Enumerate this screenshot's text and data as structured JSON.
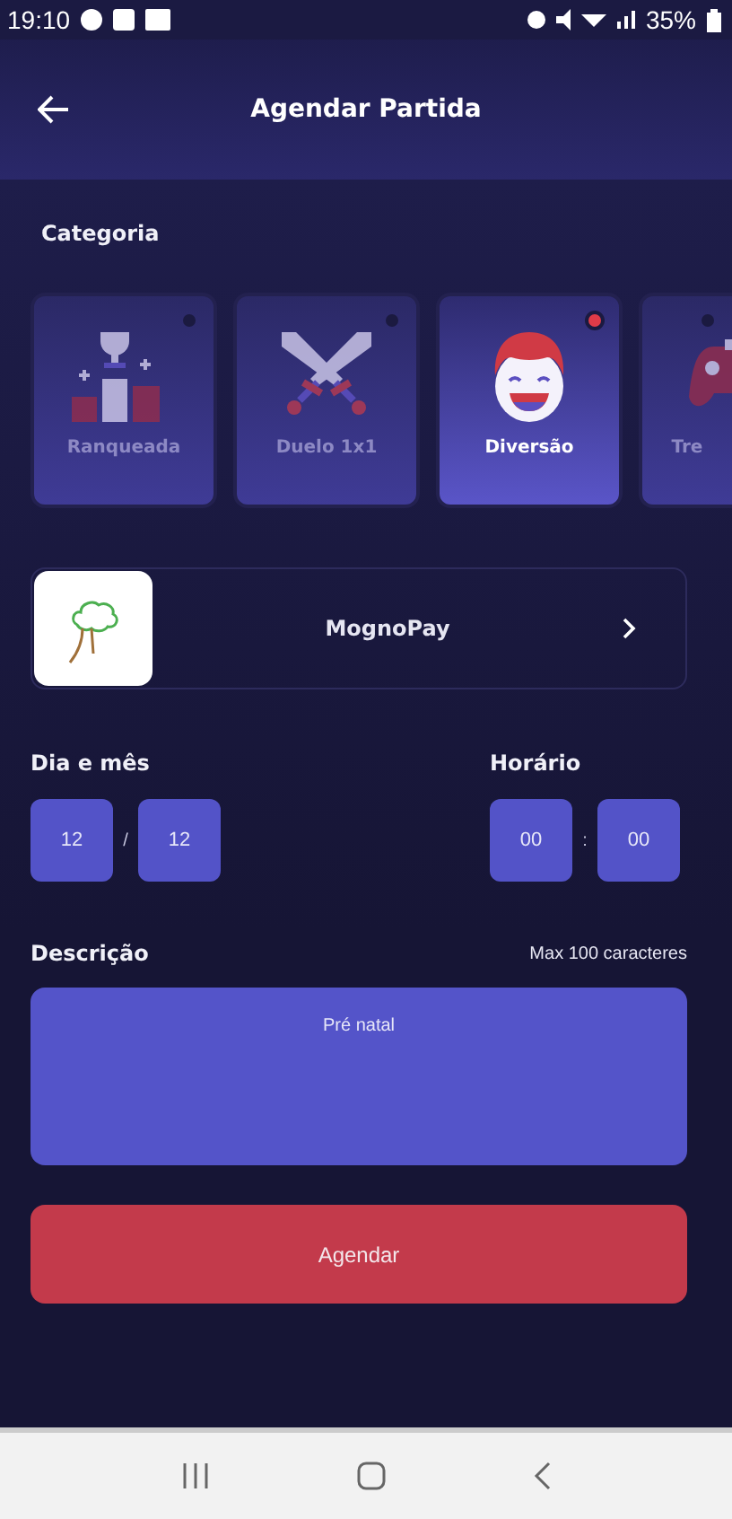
{
  "status_bar": {
    "time": "19:10",
    "battery": "35%"
  },
  "header": {
    "title": "Agendar Partida"
  },
  "category": {
    "label": "Categoria",
    "items": [
      {
        "label": "Ranqueada",
        "kind": "trophy",
        "selected": false
      },
      {
        "label": "Duelo 1x1",
        "kind": "swords",
        "selected": false
      },
      {
        "label": "Diversão",
        "kind": "face",
        "selected": true
      },
      {
        "label": "Tre",
        "kind": "gamepad",
        "selected": false
      }
    ]
  },
  "payment": {
    "name": "MognoPay"
  },
  "date": {
    "label": "Dia e mês",
    "day": "12",
    "separator": "/",
    "month": "12"
  },
  "time": {
    "label": "Horário",
    "hour": "00",
    "separator": ":",
    "minute": "00"
  },
  "description": {
    "label": "Descrição",
    "hint": "Max 100 caracteres",
    "value": "Pré natal"
  },
  "submit": {
    "label": "Agendar"
  }
}
